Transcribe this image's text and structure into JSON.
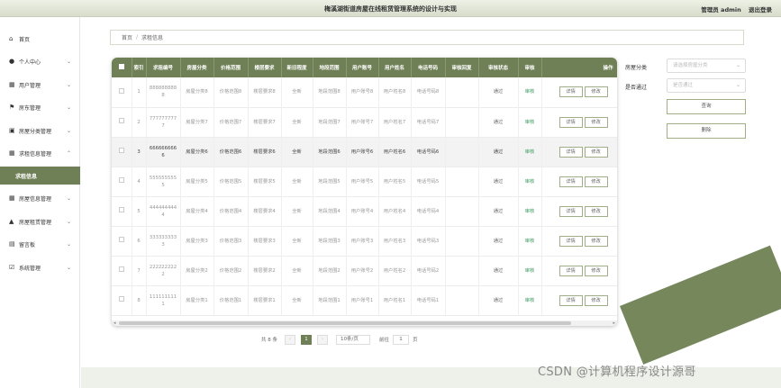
{
  "header": {
    "title": "梅溪湖街道房屋在线租赁管理系统的设计与实现",
    "user_label": "管理员 admin",
    "logout": "退出登录"
  },
  "sidebar": {
    "items": [
      {
        "icon": "home-icon",
        "glyph": "⌂",
        "label": "首页",
        "chevron": ""
      },
      {
        "icon": "person-icon",
        "glyph": "●",
        "label": "个人中心",
        "chevron": "⌄"
      },
      {
        "icon": "grid-icon",
        "glyph": "▦",
        "label": "用户管理",
        "chevron": "⌄"
      },
      {
        "icon": "flag-icon",
        "glyph": "⚑",
        "label": "房东管理",
        "chevron": "⌄"
      },
      {
        "icon": "box-icon",
        "glyph": "▣",
        "label": "房屋分类管理",
        "chevron": "⌄"
      },
      {
        "icon": "grid-icon",
        "glyph": "▦",
        "label": "求租信息管理",
        "chevron": "⌃"
      },
      {
        "icon": "",
        "glyph": "",
        "label": "求租信息",
        "chevron": ""
      },
      {
        "icon": "grid-icon",
        "glyph": "▦",
        "label": "房屋信息管理",
        "chevron": "⌄"
      },
      {
        "icon": "lamp-icon",
        "glyph": "▲",
        "label": "房屋租赁管理",
        "chevron": "⌄"
      },
      {
        "icon": "board-icon",
        "glyph": "▤",
        "label": "留言板",
        "chevron": "⌄"
      },
      {
        "icon": "checkbox-icon",
        "glyph": "☑",
        "label": "系统管理",
        "chevron": "⌄"
      }
    ]
  },
  "breadcrumb": {
    "home": "首页",
    "sep": "/",
    "current": "求租信息"
  },
  "table": {
    "headers": [
      "",
      "索引",
      "求租编号",
      "房屋分类",
      "价格范围",
      "楼层要求",
      "新旧程度",
      "地段范围",
      "用户账号",
      "用户姓名",
      "电话号码",
      "审核回复",
      "审核状态",
      "审核",
      "操作"
    ],
    "rows": [
      {
        "idx": "1",
        "code": "8888888888",
        "cat": "房屋分类8",
        "price": "价格范围8",
        "floor": "楼层要求8",
        "cond": "全新",
        "area": "地段范围8",
        "acct": "用户账号8",
        "name": "用户姓名8",
        "phone": "电话号码8",
        "reply": "",
        "status": "通过",
        "audit": "审核",
        "detail": "详情",
        "edit": "修改"
      },
      {
        "idx": "2",
        "code": "7777777777",
        "cat": "房屋分类7",
        "price": "价格范围7",
        "floor": "楼层要求7",
        "cond": "全新",
        "area": "地段范围7",
        "acct": "用户账号7",
        "name": "用户姓名7",
        "phone": "电话号码7",
        "reply": "",
        "status": "通过",
        "audit": "审核",
        "detail": "详情",
        "edit": "修改"
      },
      {
        "idx": "3",
        "code": "6666666666",
        "cat": "房屋分类6",
        "price": "价格范围6",
        "floor": "楼层要求6",
        "cond": "全新",
        "area": "地段范围6",
        "acct": "用户账号6",
        "name": "用户姓名6",
        "phone": "电话号码6",
        "reply": "",
        "status": "通过",
        "audit": "审核",
        "detail": "详情",
        "edit": "修改"
      },
      {
        "idx": "4",
        "code": "5555555555",
        "cat": "房屋分类5",
        "price": "价格范围5",
        "floor": "楼层要求5",
        "cond": "全新",
        "area": "地段范围5",
        "acct": "用户账号5",
        "name": "用户姓名5",
        "phone": "电话号码5",
        "reply": "",
        "status": "通过",
        "audit": "审核",
        "detail": "详情",
        "edit": "修改"
      },
      {
        "idx": "5",
        "code": "4444444444",
        "cat": "房屋分类4",
        "price": "价格范围4",
        "floor": "楼层要求4",
        "cond": "全新",
        "area": "地段范围4",
        "acct": "用户账号4",
        "name": "用户姓名4",
        "phone": "电话号码4",
        "reply": "",
        "status": "通过",
        "audit": "审核",
        "detail": "详情",
        "edit": "修改"
      },
      {
        "idx": "6",
        "code": "3333333333",
        "cat": "房屋分类3",
        "price": "价格范围3",
        "floor": "楼层要求3",
        "cond": "全新",
        "area": "地段范围3",
        "acct": "用户账号3",
        "name": "用户姓名3",
        "phone": "电话号码3",
        "reply": "",
        "status": "通过",
        "audit": "审核",
        "detail": "详情",
        "edit": "修改"
      },
      {
        "idx": "7",
        "code": "2222222222",
        "cat": "房屋分类2",
        "price": "价格范围2",
        "floor": "楼层要求2",
        "cond": "全新",
        "area": "地段范围2",
        "acct": "用户账号2",
        "name": "用户姓名2",
        "phone": "电话号码2",
        "reply": "",
        "status": "通过",
        "audit": "审核",
        "detail": "详情",
        "edit": "修改"
      },
      {
        "idx": "8",
        "code": "1111111111",
        "cat": "房屋分类1",
        "price": "价格范围1",
        "floor": "楼层要求1",
        "cond": "全新",
        "area": "地段范围1",
        "acct": "用户账号1",
        "name": "用户姓名1",
        "phone": "电话号码1",
        "reply": "",
        "status": "通过",
        "audit": "审核",
        "detail": "详情",
        "edit": "修改"
      }
    ]
  },
  "pager": {
    "total": "共 8 条",
    "prev": "‹",
    "current": "1",
    "next": "›",
    "size": "10条/页",
    "goto": "前往",
    "page": "1",
    "unit": "页"
  },
  "filters": {
    "category_label": "房屋分类",
    "category_placeholder": "请选择房屋分类",
    "passed_label": "是否通过",
    "passed_placeholder": "是否通过",
    "query": "查询",
    "delete": "删除"
  },
  "watermark": "CSDN @计算机程序设计源哥",
  "colors": {
    "accent": "#6f7f56",
    "audit_link": "#3a9b5e"
  }
}
